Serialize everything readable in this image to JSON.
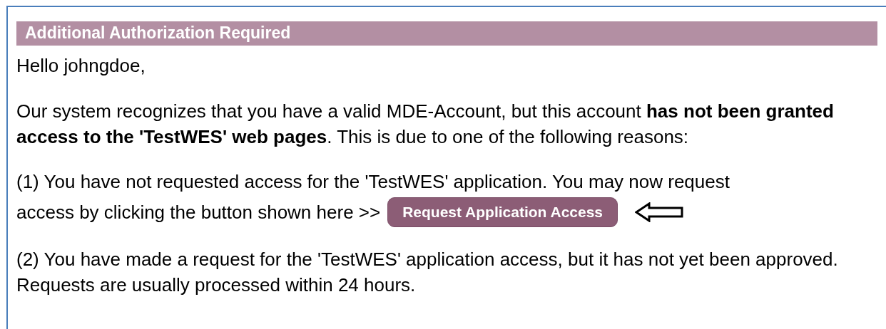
{
  "header": {
    "title": "Additional Authorization Required"
  },
  "greeting": "Hello johngdoe,",
  "paragraphs": [
    {
      "kind": "text",
      "text": "Our system recognizes that you have a valid MDE-Account, but this account **has not been granted access to the 'TestWES' web pages**. This is due to one of the following reasons:"
    },
    {
      "kind": "action",
      "text": "(1) You have not requested access for the 'TestWES' application. You may now request",
      "lead": "access by clicking the button shown here >>",
      "button": "Request Application Access"
    },
    {
      "kind": "text",
      "text": "(2) You have made a request for the 'TestWES' application access, but it has not yet been approved. Requests are usually processed within 24 hours."
    }
  ]
}
